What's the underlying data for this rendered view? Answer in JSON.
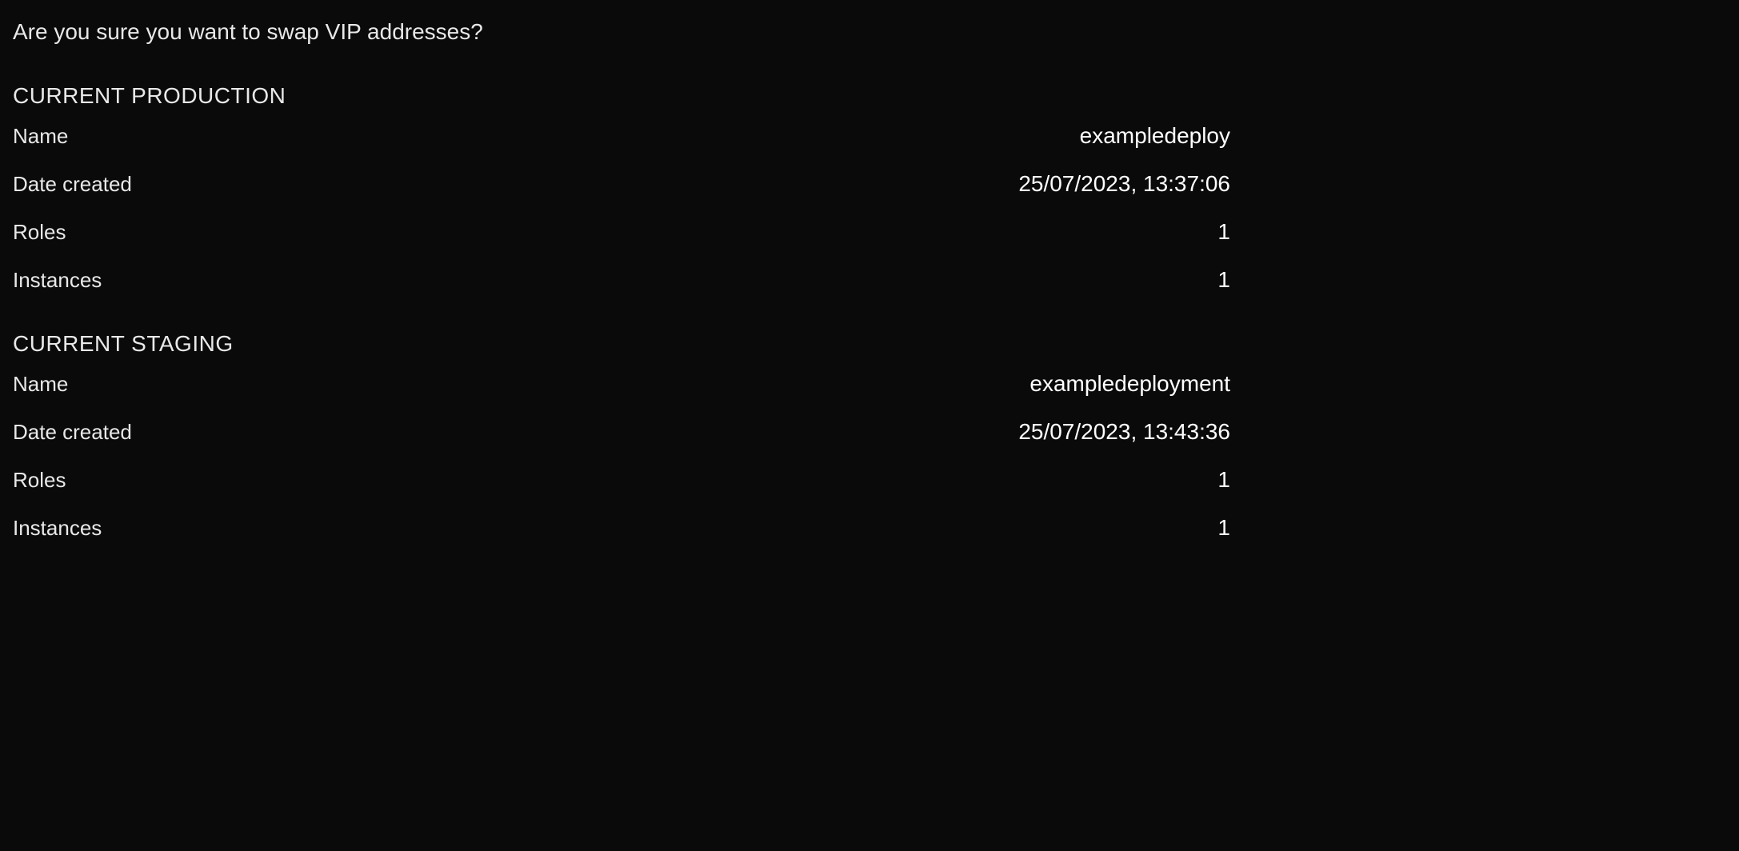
{
  "confirm_message": "Are you sure you want to swap VIP addresses?",
  "sections": {
    "production": {
      "header": "CURRENT PRODUCTION",
      "name_label": "Name",
      "name_value": "exampledeploy",
      "date_created_label": "Date created",
      "date_created_value": "25/07/2023, 13:37:06",
      "roles_label": "Roles",
      "roles_value": "1",
      "instances_label": "Instances",
      "instances_value": "1"
    },
    "staging": {
      "header": "CURRENT STAGING",
      "name_label": "Name",
      "name_value": "exampledeployment",
      "date_created_label": "Date created",
      "date_created_value": "25/07/2023, 13:43:36",
      "roles_label": "Roles",
      "roles_value": "1",
      "instances_label": "Instances",
      "instances_value": "1"
    }
  }
}
